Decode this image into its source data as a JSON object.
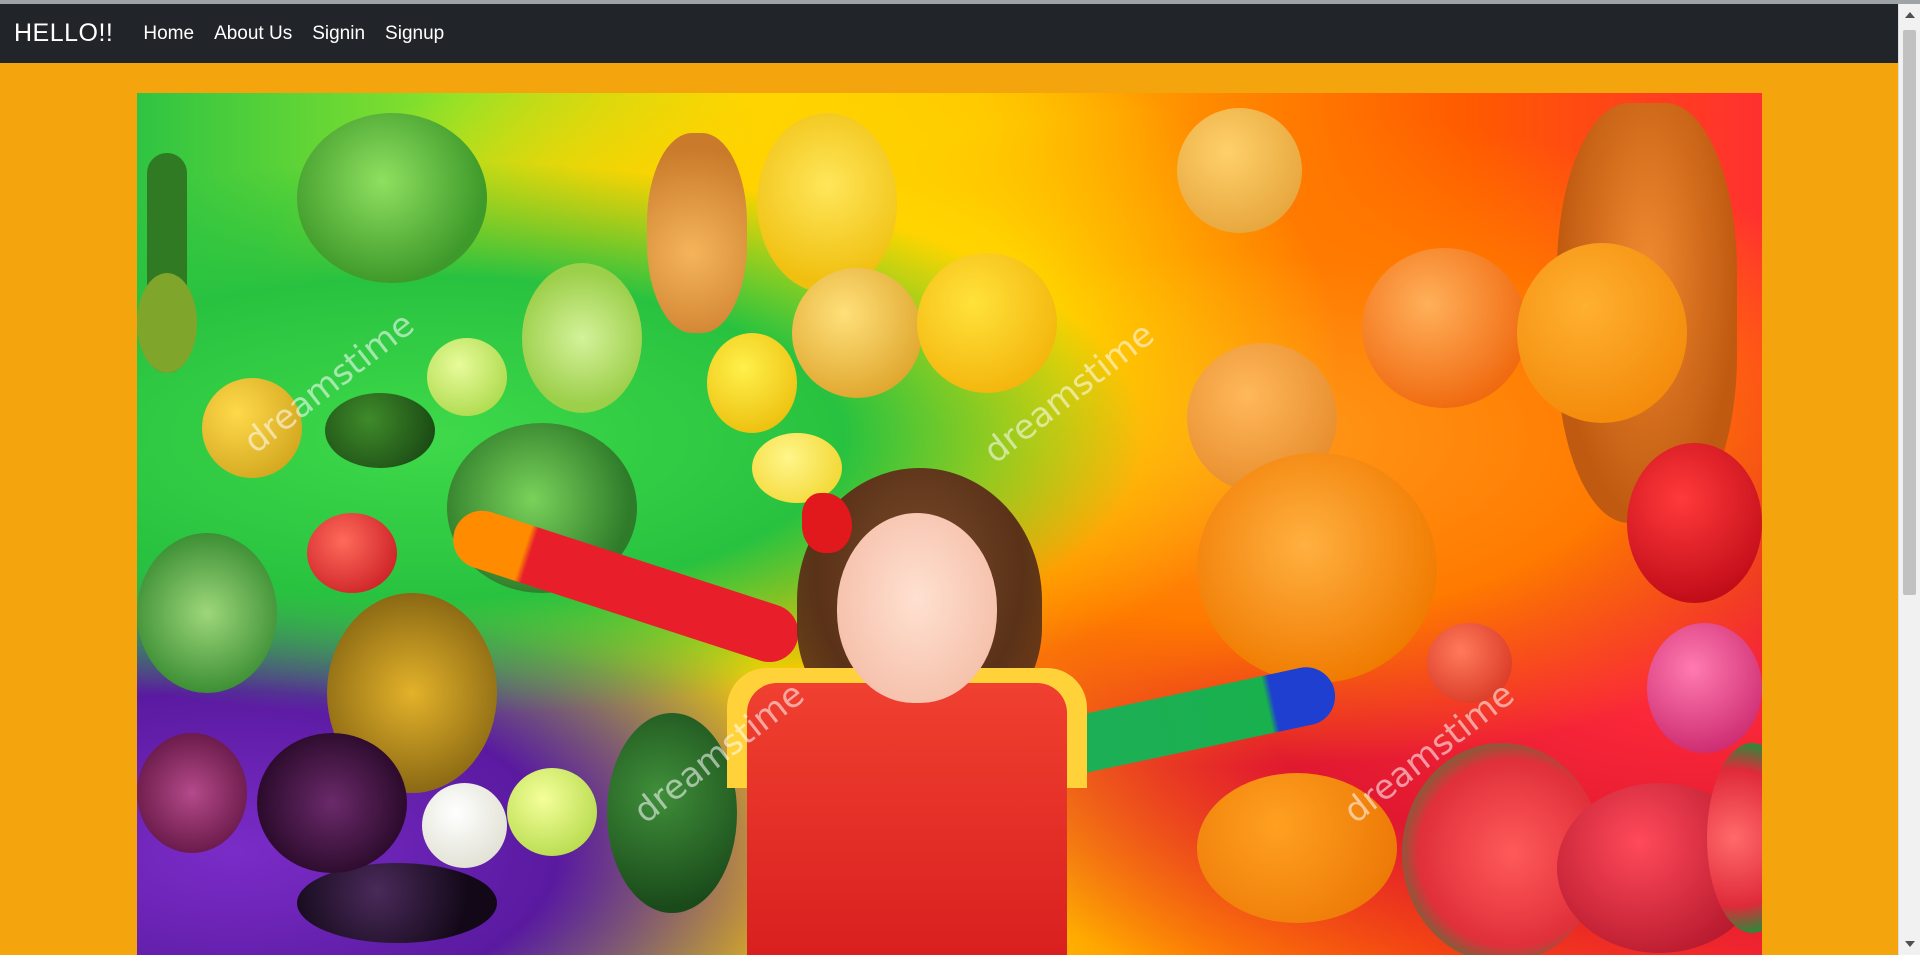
{
  "navbar": {
    "brand": "HELLO!!",
    "links": [
      "Home",
      "About Us",
      "Signin",
      "Signup"
    ]
  },
  "hero": {
    "watermark": "dreamstime",
    "image_description_icon": "fruits-vegetables-child-photo"
  },
  "colors": {
    "navbar_bg": "#212529",
    "page_bg": "#f4a40c",
    "nav_text": "#ffffff"
  }
}
